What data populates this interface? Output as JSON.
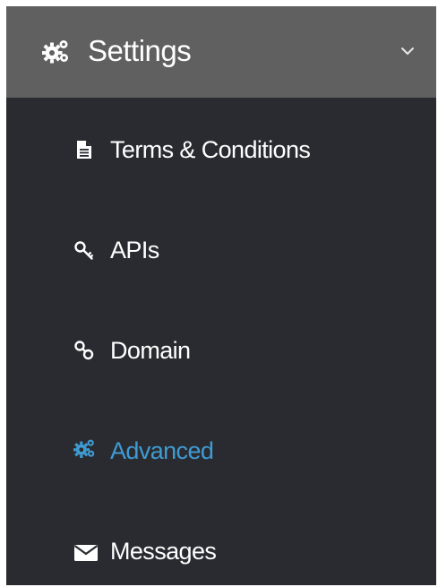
{
  "header": {
    "title": "Settings",
    "icon": "gears-icon",
    "chevron_icon": "chevron-down-icon"
  },
  "colors": {
    "panel_bg": "#2a2b30",
    "header_bg": "#606060",
    "text": "#ffffff",
    "active": "#3f9bd3"
  },
  "menu": {
    "items": [
      {
        "label": "Terms & Conditions",
        "icon": "document-icon"
      },
      {
        "label": "APIs",
        "icon": "key-icon"
      },
      {
        "label": "Domain",
        "icon": "link-icon"
      },
      {
        "label": "Advanced",
        "icon": "gears-icon",
        "active": true
      },
      {
        "label": "Messages",
        "icon": "envelope-icon"
      }
    ]
  }
}
